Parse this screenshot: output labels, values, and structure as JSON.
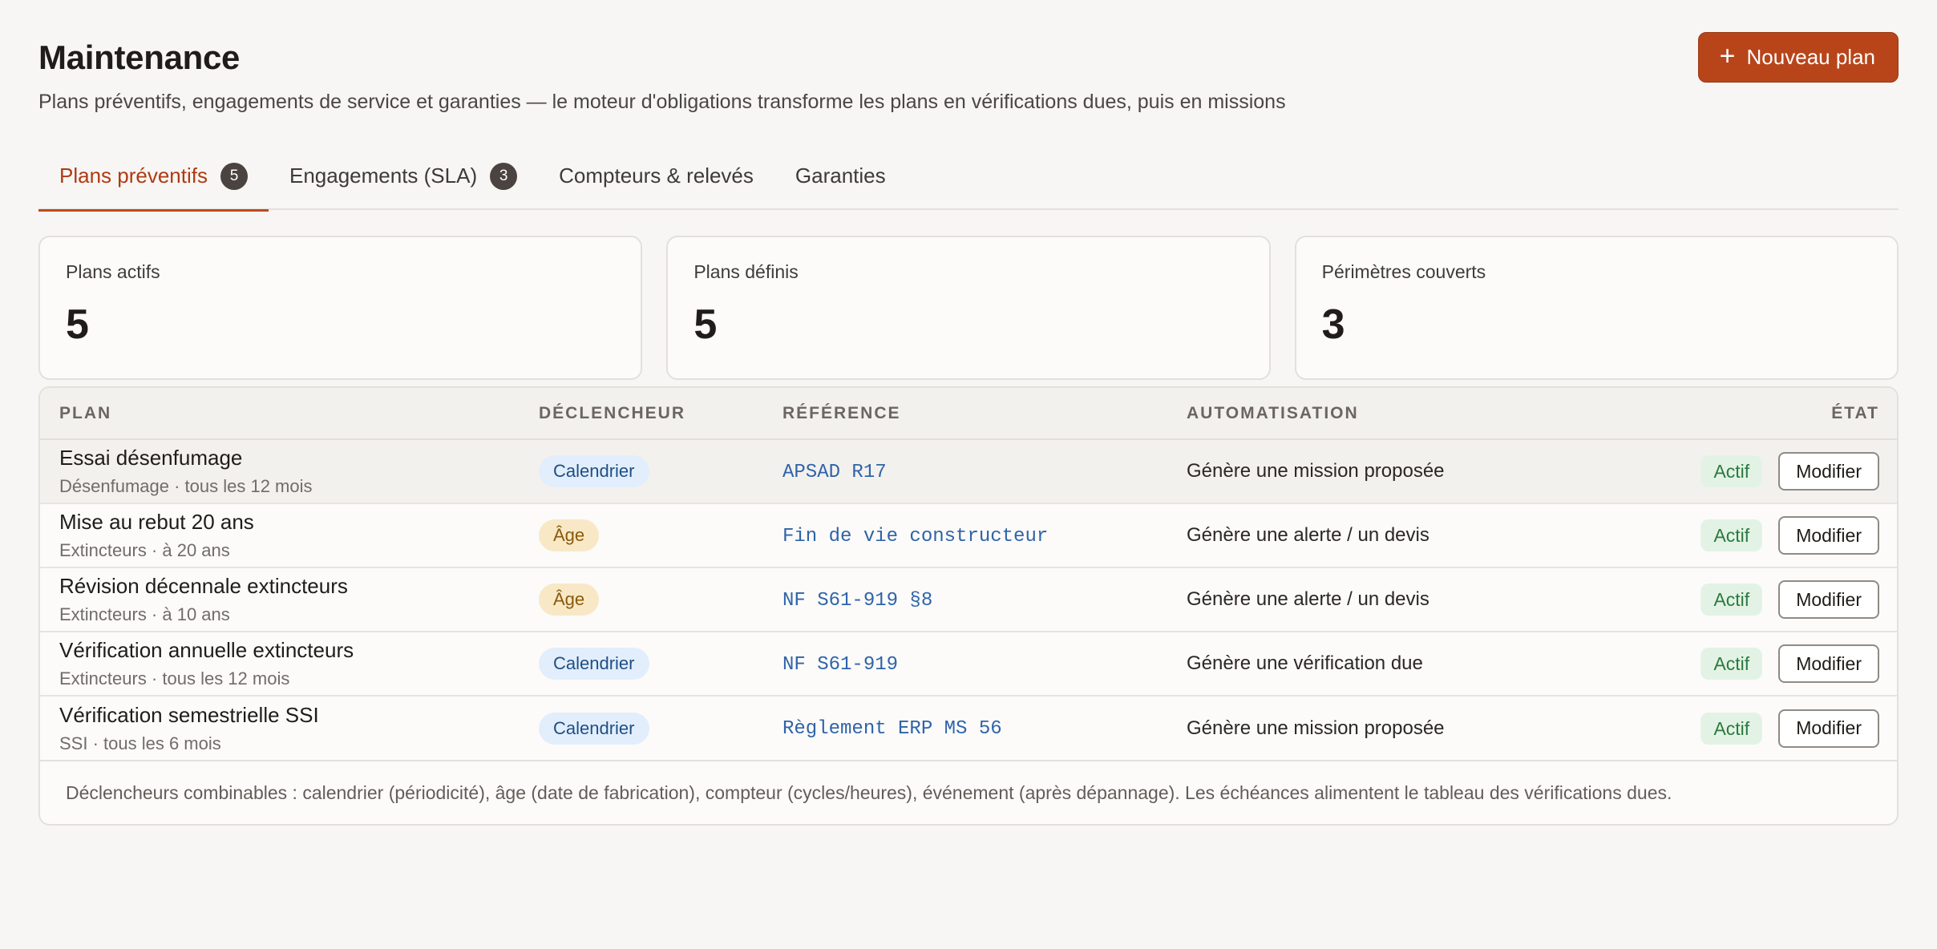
{
  "header": {
    "title": "Maintenance",
    "subtitle": "Plans préventifs, engagements de service et garanties — le moteur d'obligations transforme les plans en vérifications dues, puis en missions",
    "new_button_icon": "plus-icon",
    "new_button_label": "Nouveau plan"
  },
  "tabs": [
    {
      "label": "Plans préventifs",
      "badge": "5",
      "active": true
    },
    {
      "label": "Engagements (SLA)",
      "badge": "3",
      "active": false
    },
    {
      "label": "Compteurs & relevés",
      "active": false
    },
    {
      "label": "Garanties",
      "active": false
    }
  ],
  "stats": [
    {
      "label": "Plans actifs",
      "value": "5"
    },
    {
      "label": "Plans définis",
      "value": "5"
    },
    {
      "label": "Périmètres couverts",
      "value": "3"
    }
  ],
  "table": {
    "columns": {
      "plan": "PLAN",
      "trigger": "DÉCLENCHEUR",
      "reference": "RÉFÉRENCE",
      "automation": "AUTOMATISATION",
      "state": "ÉTAT"
    },
    "rows": [
      {
        "name": "Essai désenfumage",
        "detail": "Désenfumage · tous les 12 mois",
        "trigger": "Calendrier",
        "reference": "APSAD R17",
        "automation": "Génère une mission proposée",
        "status": "Actif",
        "action": "Modifier"
      },
      {
        "name": "Mise au rebut 20 ans",
        "detail": "Extincteurs · à 20 ans",
        "trigger": "Âge",
        "reference": "Fin de vie constructeur",
        "automation": "Génère une alerte / un devis",
        "status": "Actif",
        "action": "Modifier"
      },
      {
        "name": "Révision décennale extincteurs",
        "detail": "Extincteurs · à 10 ans",
        "trigger": "Âge",
        "reference": "NF S61-919 §8",
        "automation": "Génère une alerte / un devis",
        "status": "Actif",
        "action": "Modifier"
      },
      {
        "name": "Vérification annuelle extincteurs",
        "detail": "Extincteurs · tous les 12 mois",
        "trigger": "Calendrier",
        "reference": "NF S61-919",
        "automation": "Génère une vérification due",
        "status": "Actif",
        "action": "Modifier"
      },
      {
        "name": "Vérification semestrielle SSI",
        "detail": "SSI · tous les 6 mois",
        "trigger": "Calendrier",
        "reference": "Règlement ERP MS 56",
        "automation": "Génère une mission proposée",
        "status": "Actif",
        "action": "Modifier"
      }
    ],
    "footer": "Déclencheurs combinables : calendrier (périodicité), âge (date de fabrication), compteur (cycles/heures), événement (après dépannage). Les échéances alimentent le tableau des vérifications dues."
  },
  "colors": {
    "accent": "#b8451a",
    "active_tab": "#b03a12",
    "calendar_pill": "#e2eefb",
    "age_pill": "#f8e8c6",
    "status_active": "#e2f3e5",
    "reference_text": "#2f64a8"
  }
}
